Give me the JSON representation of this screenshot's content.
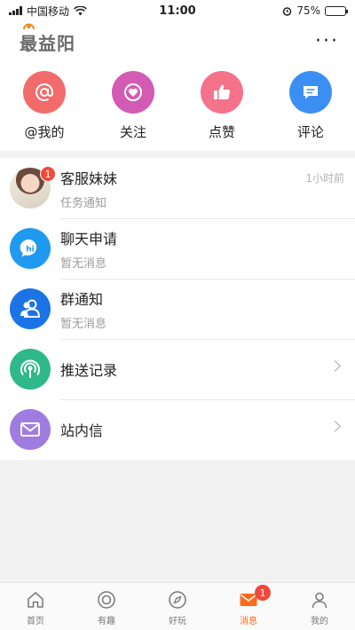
{
  "status_bar": {
    "carrier": "中国移动",
    "time": "11:00",
    "battery": "75%",
    "battery_level": 0.75
  },
  "header": {
    "logo_text": "最益阳",
    "more_icon": "more-icon"
  },
  "quick_actions": [
    {
      "label": "@我的",
      "icon": "at-icon",
      "color": "#f26b6b"
    },
    {
      "label": "关注",
      "icon": "heart-icon",
      "color": "#d35bb4"
    },
    {
      "label": "点赞",
      "icon": "thumbs-up-icon",
      "color": "#f4738a"
    },
    {
      "label": "评论",
      "icon": "comment-icon",
      "color": "#3c8ff2"
    }
  ],
  "messages": [
    {
      "title": "客服妹妹",
      "subtitle": "任务通知",
      "time": "1小时前",
      "badge": "1",
      "icon": "avatar"
    },
    {
      "title": "聊天申请",
      "subtitle": "暂无消息",
      "icon": "hi-chat-icon",
      "color": "#1f9af0"
    },
    {
      "title": "群通知",
      "subtitle": "暂无消息",
      "icon": "group-icon",
      "color": "#1a74e6"
    },
    {
      "title": "推送记录",
      "icon": "broadcast-icon",
      "color": "#2fb88a"
    },
    {
      "title": "站内信",
      "icon": "mail-icon",
      "color": "#a07ce0"
    }
  ],
  "tabbar": [
    {
      "label": "首页",
      "icon": "home-icon"
    },
    {
      "label": "有趣",
      "icon": "circle-icon"
    },
    {
      "label": "好玩",
      "icon": "compass-icon"
    },
    {
      "label": "消息",
      "icon": "message-icon",
      "active": true,
      "badge": "1"
    },
    {
      "label": "我的",
      "icon": "profile-icon"
    }
  ],
  "colors": {
    "accent": "#ff6a1a",
    "badge": "#f04a3a"
  }
}
